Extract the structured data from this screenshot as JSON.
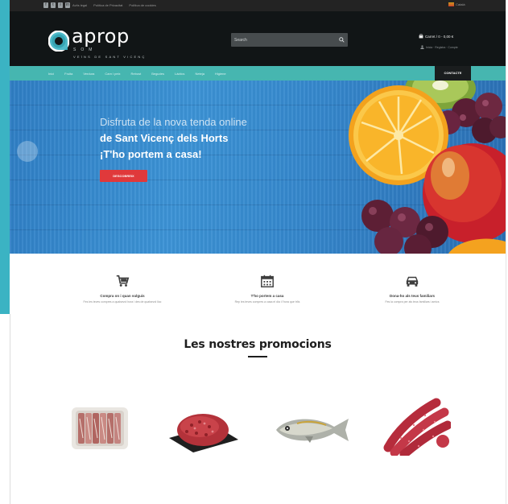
{
  "topbar": {
    "links": [
      "Aviís legal",
      "Política de Privacitat",
      "Política de cookies"
    ],
    "language": "Català"
  },
  "brand": {
    "name": "aprop",
    "tagline_1": "SOM",
    "tagline_2": "VEÏNS DE SANT VICENÇ"
  },
  "search": {
    "placeholder": "Search"
  },
  "cart": {
    "label": "Carret / 0 - 0,00 €"
  },
  "account": {
    "label": "Inicia · Registra · Compte"
  },
  "nav": {
    "items": [
      "Inici",
      "Fruita",
      "Verdura",
      "Carn i peix",
      "Rebost",
      "Begudes",
      "Làctics",
      "Neteja",
      "Higiene"
    ],
    "cta": "CONTACTE"
  },
  "hero": {
    "line1": "Disfruta de la nova tenda online",
    "line2": "de Sant Vicenç dels Horts",
    "line3": "¡T'ho portem a casa!",
    "button": "DESCOBREIX"
  },
  "features": [
    {
      "icon": "cart-icon",
      "title": "Compra on i quan vulguis",
      "desc": "Fes les teves compres a qualsevol hora i des de qualsevol lloc"
    },
    {
      "icon": "calendar-icon",
      "title": "T'ho portem a casa",
      "desc": "Rep les teves compres a casa el dia i l'hora que triïs"
    },
    {
      "icon": "car-icon",
      "title": "Dona-ho als teus familiars",
      "desc": "Fes la compra per als teus familiars i amics"
    }
  ],
  "promotions": {
    "title": "Les nostres promocions",
    "items": [
      {
        "name": "bacon-tray"
      },
      {
        "name": "minced-meat"
      },
      {
        "name": "sea-bream"
      },
      {
        "name": "sausages"
      }
    ]
  },
  "colors": {
    "accent_teal": "#46b6b0",
    "left_accent": "#3bb3c3",
    "header_dark": "#111516",
    "topbar_dark": "#232323",
    "hero_blue": "#3587cc",
    "button_red": "#e0393b"
  }
}
